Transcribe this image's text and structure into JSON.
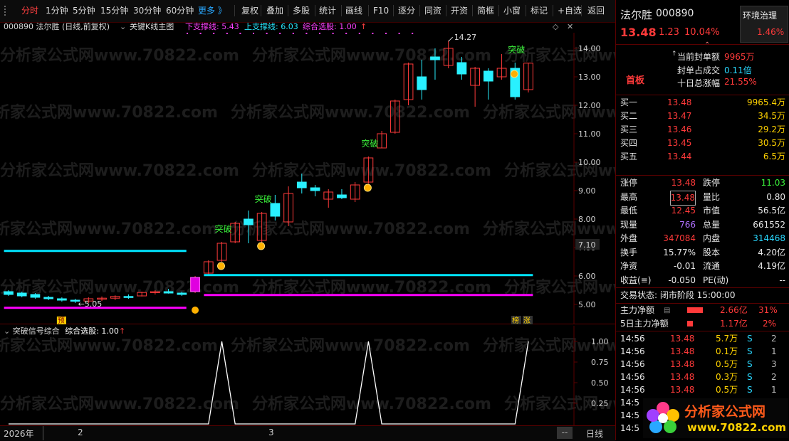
{
  "toolbar": {
    "items": [
      "分时",
      "1分钟",
      "5分钟",
      "15分钟",
      "30分钟",
      "60分钟",
      "更多 》",
      "复权",
      "叠加",
      "多股",
      "统计",
      "画线",
      "F10",
      "逐分",
      "同资",
      "开资",
      "简框",
      "小窗",
      "标记",
      "+自选",
      "返回"
    ]
  },
  "chart_header": {
    "stock": "000890 法尔胜 (日线,前复权)",
    "indicator": "关键K线主图",
    "lower_support": "下支撑线: 5.43",
    "upper_support": "上支撑线: 6.03",
    "combined": "综合选股: 1.00",
    "up_arrow": "↑"
  },
  "main_axis": {
    "labels": [
      "14.00",
      "13.00",
      "12.00",
      "11.00",
      "10.00",
      "9.00",
      "8.00",
      "7.00",
      "6.00",
      "5.00"
    ],
    "current_price_tag": "7.10"
  },
  "annotations": {
    "high": "14.27",
    "low": "5.05",
    "breakout": "突破",
    "pre": "预",
    "lhb_1": "榜",
    "lhb_2": "涨"
  },
  "sub_chart": {
    "title": "突破信号综合",
    "value": "综合选股: 1.00",
    "arrow": "↑",
    "axis_labels": [
      "1.00",
      "0.75",
      "0.50",
      "0.25"
    ]
  },
  "bottom_bar": {
    "year": "2026年",
    "month_2": "2",
    "month_3": "3",
    "scroll": "--",
    "period": "日线"
  },
  "quote": {
    "name": "法尔胜",
    "code": "000890",
    "tag": "环境治理",
    "tag_value": "1.46%",
    "price": "13.48",
    "change": "1.23",
    "change_pct": "10.04%",
    "board": "首板",
    "seal_label": "当前封单额",
    "seal_value": "9965万",
    "seal_ratio_label": "封单占成交",
    "seal_ratio_value": "0.11倍",
    "ten_day_label": "十日总涨幅",
    "ten_day_value": "21.55%"
  },
  "order_book": [
    {
      "label": "买一",
      "price": "13.48",
      "vol": "9965.4万"
    },
    {
      "label": "买二",
      "price": "13.47",
      "vol": "34.5万"
    },
    {
      "label": "买三",
      "price": "13.46",
      "vol": "29.2万"
    },
    {
      "label": "买四",
      "price": "13.45",
      "vol": "30.5万"
    },
    {
      "label": "买五",
      "price": "13.44",
      "vol": "6.5万"
    }
  ],
  "stats": [
    {
      "l1": "涨停",
      "v1": "13.48",
      "l2": "跌停",
      "v2": "11.03"
    },
    {
      "l1": "最高",
      "v1": "13.48",
      "l2": "量比",
      "v2": "0.80"
    },
    {
      "l1": "最低",
      "v1": "12.45",
      "l2": "市值",
      "v2": "56.5亿"
    },
    {
      "l1": "现量",
      "v1": "766",
      "l2": "总量",
      "v2": "661552"
    },
    {
      "l1": "外盘",
      "v1": "347084",
      "l2": "内盘",
      "v2": "314468"
    },
    {
      "l1": "换手",
      "v1": "15.77%",
      "l2": "股本",
      "v2": "4.20亿"
    },
    {
      "l1": "净资",
      "v1": "-0.01",
      "l2": "流通",
      "v2": "4.19亿"
    },
    {
      "l1": "收益(≡)",
      "v1": "-0.050",
      "l2": "PE(动)",
      "v2": "--"
    }
  ],
  "status": "交易状态: 闭市阶段 15:00:00",
  "main_flow": {
    "label": "主力净额",
    "value": "2.66亿",
    "pct": "31%"
  },
  "five_day_flow": {
    "label": "5日主力净额",
    "value": "1.17亿",
    "pct": "2%"
  },
  "ticks": [
    {
      "time": "14:56",
      "price": "13.48",
      "vol": "5.7万",
      "side": "S",
      "n": "2"
    },
    {
      "time": "14:56",
      "price": "13.48",
      "vol": "0.1万",
      "side": "S",
      "n": "1"
    },
    {
      "time": "14:56",
      "price": "13.48",
      "vol": "0.5万",
      "side": "S",
      "n": "3"
    },
    {
      "time": "14:56",
      "price": "13.48",
      "vol": "0.3万",
      "side": "S",
      "n": "2"
    },
    {
      "time": "14:56",
      "price": "13.48",
      "vol": "0.5万",
      "side": "S",
      "n": "1"
    },
    {
      "time": "14:5",
      "price": "",
      "vol": "",
      "side": "",
      "n": ""
    },
    {
      "time": "14:5",
      "price": "",
      "vol": "",
      "side": "",
      "n": ""
    },
    {
      "time": "14:5",
      "price": "",
      "vol": "",
      "side": "",
      "n": ""
    }
  ],
  "logo": {
    "text": "分析家公式网",
    "url": "www.70822.com"
  },
  "watermark": "分析家公式网www.70822.com",
  "colors": {
    "up": "#ff3a3a",
    "down": "#29f0ff",
    "support_upper": "#00e5ff",
    "support_lower": "#ff00ff",
    "breakout": "#3af03a"
  },
  "chart_data": {
    "type": "candlestick",
    "ylim": [
      4.6,
      14.4
    ],
    "candles": [
      {
        "o": 5.45,
        "h": 5.5,
        "l": 5.3,
        "c": 5.35
      },
      {
        "o": 5.4,
        "h": 5.45,
        "l": 5.25,
        "c": 5.3
      },
      {
        "o": 5.35,
        "h": 5.4,
        "l": 5.2,
        "c": 5.25
      },
      {
        "o": 5.25,
        "h": 5.3,
        "l": 5.15,
        "c": 5.2
      },
      {
        "o": 5.2,
        "h": 5.25,
        "l": 5.1,
        "c": 5.15
      },
      {
        "o": 5.15,
        "h": 5.2,
        "l": 5.05,
        "c": 5.12
      },
      {
        "o": 5.12,
        "h": 5.25,
        "l": 5.05,
        "c": 5.2
      },
      {
        "o": 5.2,
        "h": 5.28,
        "l": 5.12,
        "c": 5.22
      },
      {
        "o": 5.22,
        "h": 5.32,
        "l": 5.15,
        "c": 5.28
      },
      {
        "o": 5.28,
        "h": 5.35,
        "l": 5.2,
        "c": 5.25
      },
      {
        "o": 5.3,
        "h": 5.45,
        "l": 5.28,
        "c": 5.42
      },
      {
        "o": 5.42,
        "h": 5.5,
        "l": 5.35,
        "c": 5.45
      },
      {
        "o": 5.45,
        "h": 5.55,
        "l": 5.38,
        "c": 5.4
      },
      {
        "o": 5.4,
        "h": 5.45,
        "l": 5.3,
        "c": 5.35
      },
      {
        "o": 5.45,
        "h": 6.0,
        "l": 5.4,
        "c": 5.95
      },
      {
        "o": 6.1,
        "h": 6.55,
        "l": 6.05,
        "c": 6.5
      },
      {
        "o": 6.55,
        "h": 7.2,
        "l": 6.5,
        "c": 7.15
      },
      {
        "o": 7.2,
        "h": 7.9,
        "l": 7.15,
        "c": 7.85
      },
      {
        "o": 8.0,
        "h": 8.3,
        "l": 7.15,
        "c": 7.8
      },
      {
        "o": 7.25,
        "h": 8.25,
        "l": 7.15,
        "c": 8.2
      },
      {
        "o": 8.55,
        "h": 8.85,
        "l": 7.95,
        "c": 8.1
      },
      {
        "o": 7.9,
        "h": 9.15,
        "l": 7.75,
        "c": 8.9
      },
      {
        "o": 9.3,
        "h": 9.6,
        "l": 8.9,
        "c": 9.1
      },
      {
        "o": 9.1,
        "h": 9.2,
        "l": 8.8,
        "c": 9.0
      },
      {
        "o": 8.7,
        "h": 9.05,
        "l": 8.4,
        "c": 8.95
      },
      {
        "o": 8.85,
        "h": 9.05,
        "l": 8.7,
        "c": 8.75
      },
      {
        "o": 8.7,
        "h": 9.3,
        "l": 8.6,
        "c": 9.2
      },
      {
        "o": 9.3,
        "h": 10.2,
        "l": 9.25,
        "c": 10.15
      },
      {
        "o": 10.5,
        "h": 11.1,
        "l": 10.5,
        "c": 11.0
      },
      {
        "o": 11.05,
        "h": 12.2,
        "l": 11.0,
        "c": 12.15
      },
      {
        "o": 12.2,
        "h": 13.5,
        "l": 12.0,
        "c": 13.45
      },
      {
        "o": 13.0,
        "h": 13.6,
        "l": 12.2,
        "c": 12.55
      },
      {
        "o": 13.7,
        "h": 14.0,
        "l": 12.9,
        "c": 13.6
      },
      {
        "o": 13.4,
        "h": 14.27,
        "l": 13.3,
        "c": 14.0
      },
      {
        "o": 13.5,
        "h": 13.7,
        "l": 12.9,
        "c": 13.1
      },
      {
        "o": 12.7,
        "h": 13.35,
        "l": 11.95,
        "c": 13.3
      },
      {
        "o": 13.2,
        "h": 13.3,
        "l": 12.2,
        "c": 12.85
      },
      {
        "o": 13.0,
        "h": 13.8,
        "l": 12.9,
        "c": 13.3
      },
      {
        "o": 13.3,
        "h": 13.5,
        "l": 12.2,
        "c": 12.3
      },
      {
        "o": 12.55,
        "h": 13.48,
        "l": 12.45,
        "c": 13.48
      }
    ],
    "upper_support": 6.03,
    "lower_support": 5.43,
    "signal": [
      0,
      0,
      0,
      0,
      0,
      0,
      0,
      0,
      0,
      0,
      0,
      0,
      0,
      0,
      0,
      0,
      1,
      0,
      0,
      0,
      0,
      0,
      0,
      0,
      0,
      0,
      0,
      1,
      0,
      0,
      0,
      0,
      0,
      0,
      0,
      0,
      0,
      0,
      0,
      1
    ]
  }
}
